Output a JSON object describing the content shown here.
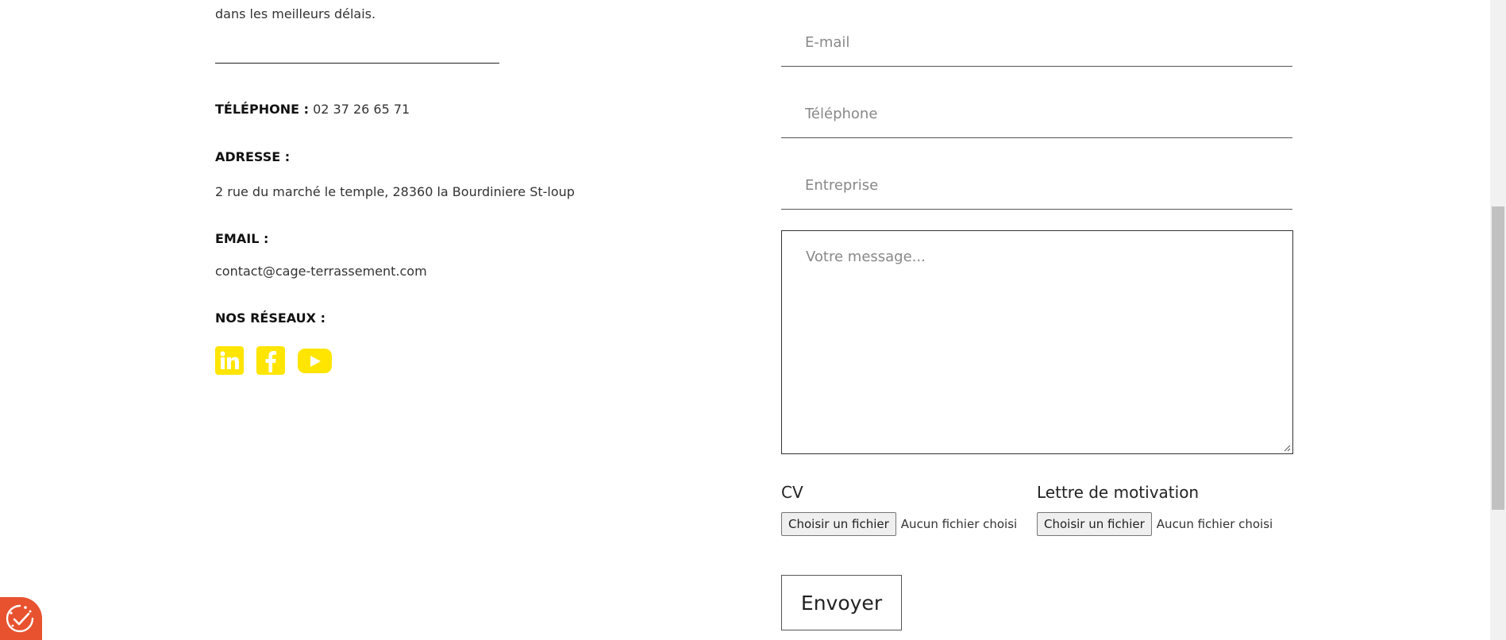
{
  "contact_info": {
    "intro_text": "dans les meilleurs délais.",
    "phone_label": "TÉLÉPHONE  :",
    "phone_value": "02 37 26 65 71",
    "address_label": "ADRESSE :",
    "address_value": "2 rue du marché le temple, 28360 la Bourdiniere St-loup",
    "email_label": "EMAIL :",
    "email_value": "contact@cage-terrassement.com",
    "socials_label": "NOS RÉSEAUX :",
    "socials": [
      {
        "icon": "linkedin-icon"
      },
      {
        "icon": "facebook-icon"
      },
      {
        "icon": "youtube-icon"
      }
    ],
    "accent_color": "#ffe500"
  },
  "form": {
    "email_placeholder": "E-mail",
    "phone_placeholder": "Téléphone",
    "company_placeholder": "Entreprise",
    "message_placeholder": "Votre message...",
    "cv_label": "CV",
    "cover_letter_label": "Lettre de motivation",
    "file_button_label": "Choisir un fichier",
    "file_status": "Aucun fichier choisi",
    "submit_label": "Envoyer"
  },
  "consent_badge": {
    "icon": "cookie-consent-icon",
    "color": "#e8522f"
  }
}
